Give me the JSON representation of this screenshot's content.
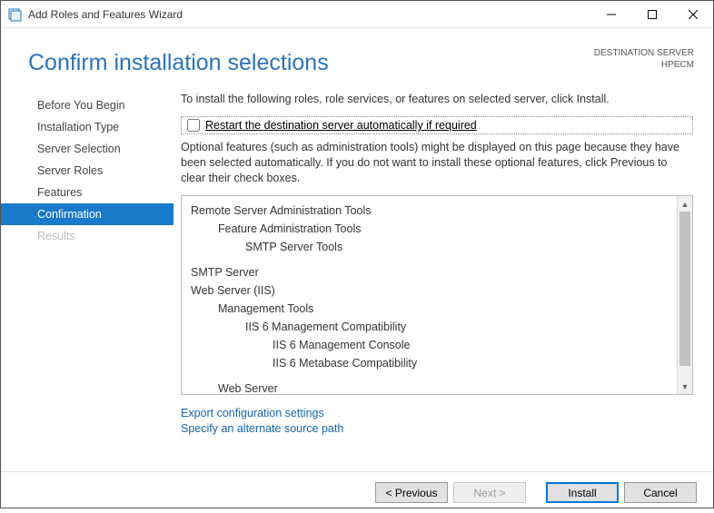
{
  "window": {
    "title": "Add Roles and Features Wizard"
  },
  "destination": {
    "label": "DESTINATION SERVER",
    "server": "HPECM"
  },
  "heading": "Confirm installation selections",
  "steps": {
    "before": "Before You Begin",
    "type": "Installation Type",
    "selection": "Server Selection",
    "roles": "Server Roles",
    "features": "Features",
    "confirmation": "Confirmation",
    "results": "Results"
  },
  "intro": "To install the following roles, role services, or features on selected server, click Install.",
  "restart_label": "Restart the destination server automatically if required",
  "optional_text": "Optional features (such as administration tools) might be displayed on this page because they have been selected automatically. If you do not want to install these optional features, click Previous to clear their check boxes.",
  "tree": {
    "rsat": "Remote Server Administration Tools",
    "fat": "Feature Administration Tools",
    "smtptools": "SMTP Server Tools",
    "smtp": "SMTP Server",
    "iis": "Web Server (IIS)",
    "mgmt": "Management Tools",
    "compat": "IIS 6 Management Compatibility",
    "console": "IIS 6 Management Console",
    "metabase": "IIS 6 Metabase Compatibility",
    "web": "Web Server"
  },
  "links": {
    "export": "Export configuration settings",
    "source": "Specify an alternate source path"
  },
  "buttons": {
    "previous": "< Previous",
    "next": "Next >",
    "install": "Install",
    "cancel": "Cancel"
  }
}
